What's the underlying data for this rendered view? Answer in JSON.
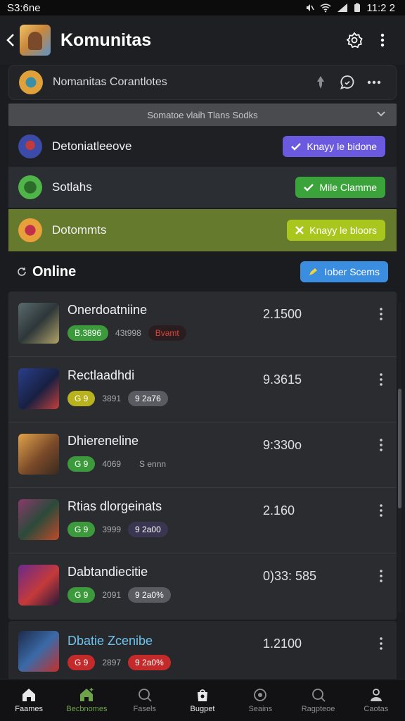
{
  "status_bar": {
    "time": "S3:6ne",
    "clock": "11:2 2"
  },
  "app_bar": {
    "title": "Komunitas"
  },
  "community": {
    "name": "Nomanitas Corantlotes"
  },
  "section": {
    "title": "Somatoe vlaih Tlans Sodks"
  },
  "features": [
    {
      "label": "Detoniatleeove",
      "button": "Knayy le bidone",
      "color": "#6a5ae0"
    },
    {
      "label": "Sotlahs",
      "button": "Mile Clamme",
      "color": "#3aa33a"
    },
    {
      "label": "Dotommts",
      "button": "Knayy le bloors",
      "color": "#a9c61f"
    }
  ],
  "online": {
    "title": "Online",
    "button": "Iober Scems"
  },
  "games": [
    {
      "name": "Onerdoatniine",
      "value": "2.1500",
      "tag1": "B.3896",
      "tag1_color": "#3c9a3c",
      "tag2": "43t998",
      "tag3": "Bvamt",
      "tag3_color": "#c0302a"
    },
    {
      "name": "Rectlaadhdi",
      "value": "9.3615",
      "tag1": "G 9",
      "tag1_color": "#b7b21e",
      "tag2": "3891",
      "tag3": "9 2a76",
      "tag3_color": "#5a5b60"
    },
    {
      "name": "Dhiereneline",
      "value": "9:330o",
      "tag1": "G 9",
      "tag1_color": "#3c9a3c",
      "tag2": "4069",
      "tag3": "S ennn",
      "tag3_color": ""
    },
    {
      "name": "Rtias dlorgeinats",
      "value": "2.160",
      "tag1": "G 9",
      "tag1_color": "#3c9a3c",
      "tag2": "3999",
      "tag3": "9 2a00",
      "tag3_color": "#3a3550"
    },
    {
      "name": "Dabtandiecitie",
      "value": "0)33: 585",
      "tag1": "G 9",
      "tag1_color": "#3c9a3c",
      "tag2": "2091",
      "tag3": "9 2a0%",
      "tag3_color": "#5a5b60"
    },
    {
      "name": "Dbatie Zcenibe",
      "value": "1.2100",
      "tag1": "G 9",
      "tag1_color": "#c42a2a",
      "tag2": "2897",
      "tag3": "9 2a0%",
      "tag3_color": "#c42a2a"
    }
  ],
  "nav": [
    {
      "label": "Faames"
    },
    {
      "label": "Becbnomes"
    },
    {
      "label": "Fasels"
    },
    {
      "label": "Bugpet"
    },
    {
      "label": "Seains"
    },
    {
      "label": "Ragpteoe"
    },
    {
      "label": "Caotas"
    }
  ]
}
